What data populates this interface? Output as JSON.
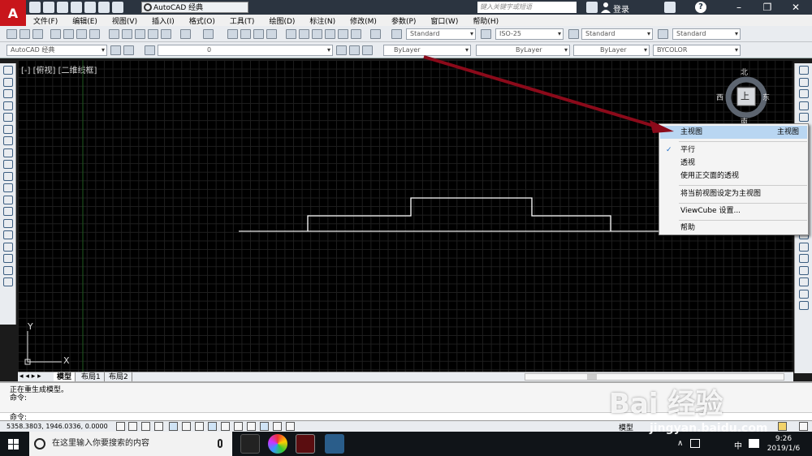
{
  "title_bar": {
    "workspace": "AutoCAD 经典",
    "search_placeholder": "键入关键字或短语",
    "login": "登录"
  },
  "menu": [
    "文件(F)",
    "编辑(E)",
    "视图(V)",
    "插入(I)",
    "格式(O)",
    "工具(T)",
    "绘图(D)",
    "标注(N)",
    "修改(M)",
    "参数(P)",
    "窗口(W)",
    "帮助(H)"
  ],
  "toolbar": {
    "text_style": "Standard",
    "dim_style": "ISO-25",
    "table_style": "Standard",
    "mleader_style": "Standard"
  },
  "layers_bar": {
    "workspace": "AutoCAD 经典",
    "layer": "0",
    "color": "ByLayer",
    "linetype": "ByLayer",
    "lineweight": "ByLayer",
    "plotstyle": "BYCOLOR"
  },
  "viewport": {
    "label": "[-] [俯视] [二维线框]"
  },
  "viewcube": {
    "north": "北",
    "south": "南",
    "east": "东",
    "west": "西",
    "face": "上"
  },
  "ucs": {
    "x": "X",
    "y": "Y"
  },
  "context_menu": {
    "items": [
      {
        "label": "主视图",
        "shortcut": "主视图",
        "highlighted": true
      },
      {
        "label": "平行",
        "checked": true
      },
      {
        "label": "透视"
      },
      {
        "label": "使用正交面的透视"
      },
      {
        "label": "将当前视图设定为主视图"
      },
      {
        "label": "ViewCube 设置..."
      },
      {
        "label": "帮助"
      }
    ]
  },
  "layout_tabs": [
    "模型",
    "布局1",
    "布局2"
  ],
  "command": {
    "line1": "正在重生成模型。",
    "line2": "命令:",
    "prompt": "命令:"
  },
  "status": {
    "coords": "5358.3803, 1946.0336, 0.0000",
    "mode": "模型"
  },
  "taskbar": {
    "search": "在这里输入你要搜索的内容",
    "ime": "中",
    "time": "9:26",
    "date": "2019/1/6"
  },
  "watermark": {
    "brand": "Bai 经验",
    "url": "jingyan.baidu.com"
  },
  "colors": {
    "arrow": "#8b0a1a",
    "highlight": "#b9d6f2",
    "canvas": "#000000",
    "shape": "#ffffff"
  }
}
